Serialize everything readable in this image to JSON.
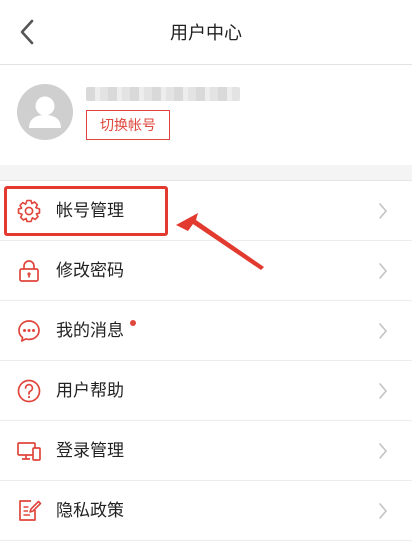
{
  "header": {
    "title": "用户中心",
    "back_icon": "chevron-left-icon"
  },
  "profile": {
    "switch_account_label": "切换帐号"
  },
  "menu": {
    "items": [
      {
        "label": "帐号管理",
        "icon": "gear-icon"
      },
      {
        "label": "修改密码",
        "icon": "lock-icon"
      },
      {
        "label": "我的消息",
        "icon": "message-bubble-icon",
        "badge_dot": true
      },
      {
        "label": "用户帮助",
        "icon": "question-circle-icon"
      },
      {
        "label": "登录管理",
        "icon": "devices-icon"
      },
      {
        "label": "隐私政策",
        "icon": "document-edit-icon"
      }
    ]
  },
  "colors": {
    "accent": "#e0463c",
    "annotation": "#e23a2e",
    "background": "#f4f4f4"
  }
}
